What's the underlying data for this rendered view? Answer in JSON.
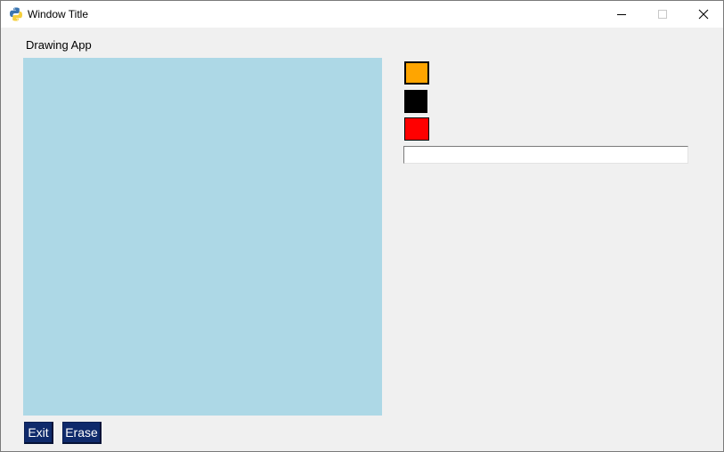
{
  "window": {
    "title": "Window Title"
  },
  "app": {
    "label": "Drawing App",
    "canvas_color": "#add8e6"
  },
  "palette": [
    {
      "name": "orange",
      "color": "#ffa500"
    },
    {
      "name": "black",
      "color": "#000000"
    },
    {
      "name": "red",
      "color": "#ff0000"
    }
  ],
  "entry": {
    "value": ""
  },
  "buttons": {
    "exit_label": "Exit",
    "erase_label": "Erase",
    "color": "#0f2a6b"
  },
  "icons": {
    "app": "python-icon",
    "minimize": "minimize-icon",
    "maximize": "maximize-icon",
    "close": "close-icon"
  }
}
